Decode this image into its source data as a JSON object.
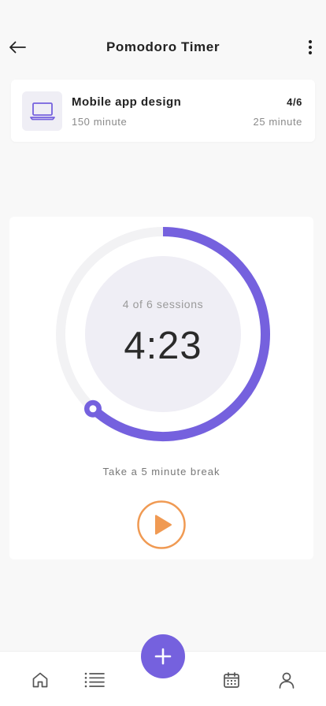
{
  "header": {
    "title": "Pomodoro Timer",
    "back_icon": "arrow-left-icon",
    "more_icon": "more-vertical-icon"
  },
  "task": {
    "icon": "laptop-icon",
    "name": "Mobile app design",
    "total": "150 minute",
    "count": "4/6",
    "duration": "25 minute"
  },
  "timer": {
    "sessions_label": "4 of 6 sessions",
    "time": "4:23",
    "progress": 0.62,
    "message": "Take a 5 minute break",
    "play_icon": "play-icon"
  },
  "nav": {
    "items": [
      "home-icon",
      "list-icon",
      "calendar-icon",
      "user-icon"
    ],
    "fab_icon": "plus-icon"
  },
  "colors": {
    "accent": "#7561de",
    "accent_light": "#efeef5",
    "play": "#f09a53",
    "track": "#f2f2f4"
  }
}
